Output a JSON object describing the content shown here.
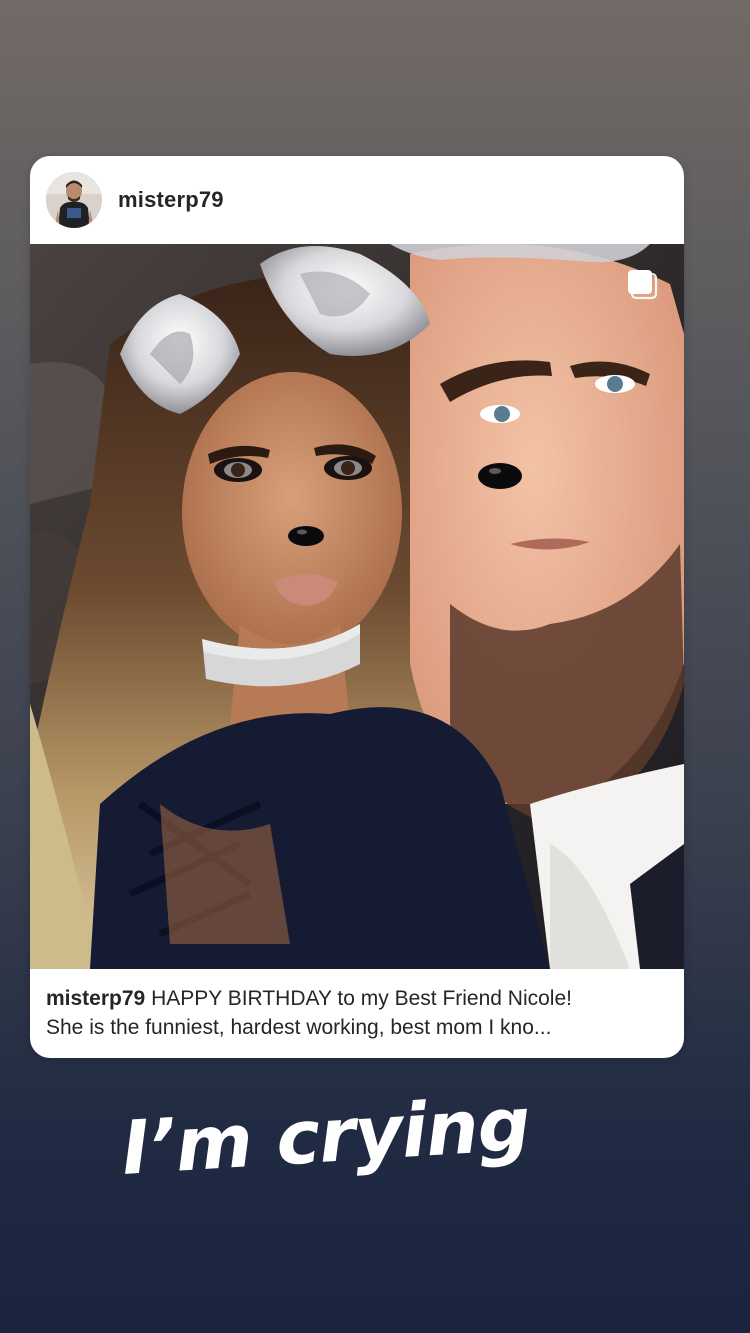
{
  "story": {
    "shared_post": {
      "username": "misterp79",
      "avatar_icon": "profile-photo",
      "photo_description_icon": "photo-image",
      "multi_photo_icon": "carousel-icon",
      "caption": {
        "username": "misterp79",
        "line1_text": "HAPPY BIRTHDAY to my Best Friend Nicole!",
        "line2_text": "She is the funniest, hardest working, best mom I kno..."
      }
    },
    "sticker_text": "I’m crying"
  },
  "colors": {
    "card_background": "#ffffff",
    "text_primary": "#262626",
    "sticker_text": "#ffffff",
    "background_top": "#726a66",
    "background_bottom": "#1b2440"
  }
}
